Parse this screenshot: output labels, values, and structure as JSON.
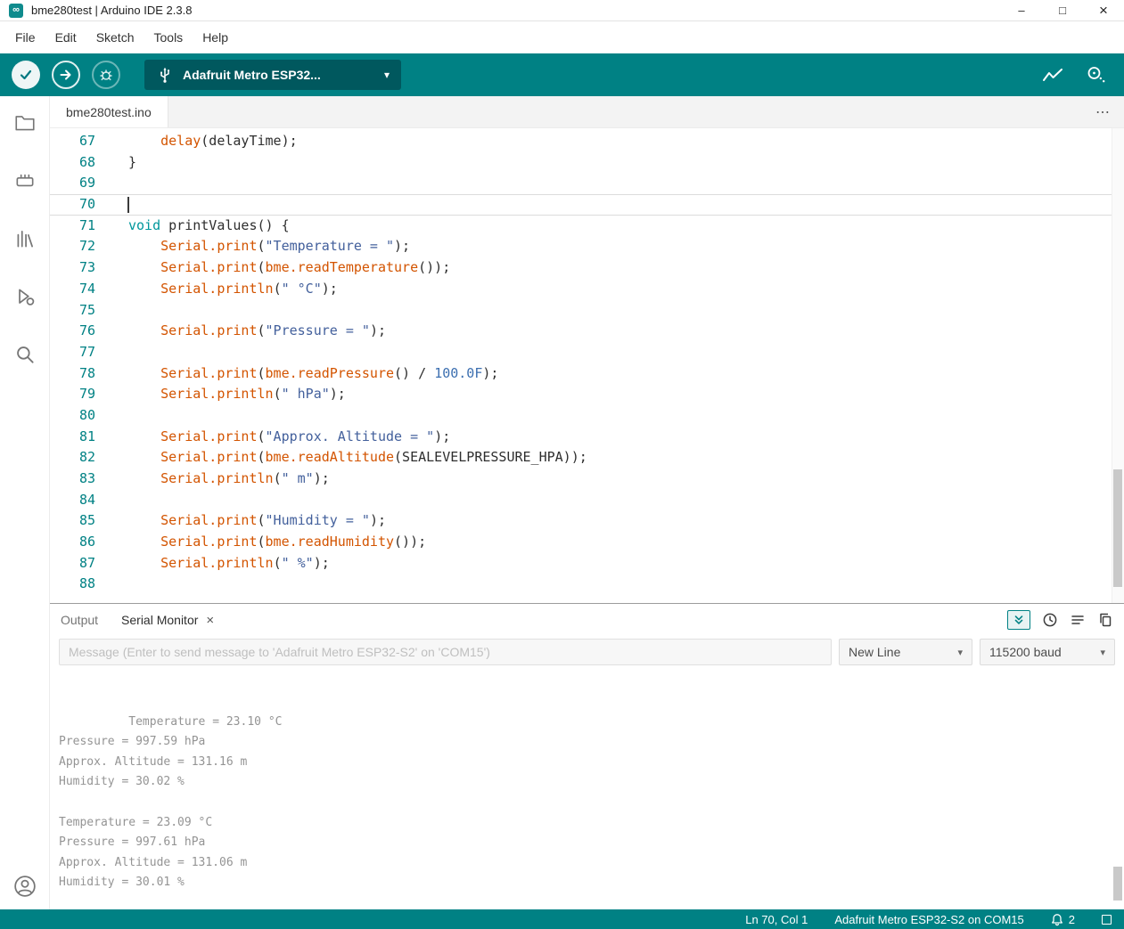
{
  "colors": {
    "accent_teal": "#008184",
    "selector_teal": "#00585e",
    "syntax_function": "#d35400",
    "syntax_keyword": "#00979c",
    "syntax_string": "#43609c",
    "syntax_number": "#3c6fb0",
    "syntax_plain": "#2e2e2e",
    "line_number": "#008184",
    "serial_text": "#949494"
  },
  "window": {
    "title": "bme280test | Arduino IDE 2.3.8",
    "controls": {
      "minimize": "–",
      "maximize": "□",
      "close": "×"
    }
  },
  "menu": {
    "items": [
      "File",
      "Edit",
      "Sketch",
      "Tools",
      "Help"
    ]
  },
  "toolbar": {
    "board_selector_label": "Adafruit Metro ESP32...",
    "dropdown_caret": "▾"
  },
  "editor_tabs": {
    "active_tab": "bme280test.ino",
    "overflow": "⋯"
  },
  "editor": {
    "lines": [
      {
        "num": 67,
        "tokens": [
          [
            "pl",
            "    "
          ],
          [
            "fn",
            "delay"
          ],
          [
            "pl",
            "(delayTime);"
          ]
        ]
      },
      {
        "num": 68,
        "tokens": [
          [
            "pl",
            "}"
          ]
        ]
      },
      {
        "num": 69,
        "tokens": []
      },
      {
        "num": 70,
        "tokens": [],
        "current": true
      },
      {
        "num": 71,
        "tokens": [
          [
            "kw",
            "void"
          ],
          [
            "pl",
            " printValues() {"
          ]
        ]
      },
      {
        "num": 72,
        "tokens": [
          [
            "pl",
            "    "
          ],
          [
            "fn",
            "Serial.print"
          ],
          [
            "pl",
            "("
          ],
          [
            "str",
            "\"Temperature = \""
          ],
          [
            "pl",
            ");"
          ]
        ]
      },
      {
        "num": 73,
        "tokens": [
          [
            "pl",
            "    "
          ],
          [
            "fn",
            "Serial.print"
          ],
          [
            "pl",
            "("
          ],
          [
            "fn",
            "bme.readTemperature"
          ],
          [
            "pl",
            "());"
          ]
        ]
      },
      {
        "num": 74,
        "tokens": [
          [
            "pl",
            "    "
          ],
          [
            "fn",
            "Serial.println"
          ],
          [
            "pl",
            "("
          ],
          [
            "str",
            "\" °C\""
          ],
          [
            "pl",
            ");"
          ]
        ]
      },
      {
        "num": 75,
        "tokens": []
      },
      {
        "num": 76,
        "tokens": [
          [
            "pl",
            "    "
          ],
          [
            "fn",
            "Serial.print"
          ],
          [
            "pl",
            "("
          ],
          [
            "str",
            "\"Pressure = \""
          ],
          [
            "pl",
            ");"
          ]
        ]
      },
      {
        "num": 77,
        "tokens": []
      },
      {
        "num": 78,
        "tokens": [
          [
            "pl",
            "    "
          ],
          [
            "fn",
            "Serial.print"
          ],
          [
            "pl",
            "("
          ],
          [
            "fn",
            "bme.readPressure"
          ],
          [
            "pl",
            "() / "
          ],
          [
            "num",
            "100.0F"
          ],
          [
            "pl",
            ");"
          ]
        ]
      },
      {
        "num": 79,
        "tokens": [
          [
            "pl",
            "    "
          ],
          [
            "fn",
            "Serial.println"
          ],
          [
            "pl",
            "("
          ],
          [
            "str",
            "\" hPa\""
          ],
          [
            "pl",
            ");"
          ]
        ]
      },
      {
        "num": 80,
        "tokens": []
      },
      {
        "num": 81,
        "tokens": [
          [
            "pl",
            "    "
          ],
          [
            "fn",
            "Serial.print"
          ],
          [
            "pl",
            "("
          ],
          [
            "str",
            "\"Approx. Altitude = \""
          ],
          [
            "pl",
            ");"
          ]
        ]
      },
      {
        "num": 82,
        "tokens": [
          [
            "pl",
            "    "
          ],
          [
            "fn",
            "Serial.print"
          ],
          [
            "pl",
            "("
          ],
          [
            "fn",
            "bme.readAltitude"
          ],
          [
            "pl",
            "(SEALEVELPRESSURE_HPA));"
          ]
        ]
      },
      {
        "num": 83,
        "tokens": [
          [
            "pl",
            "    "
          ],
          [
            "fn",
            "Serial.println"
          ],
          [
            "pl",
            "("
          ],
          [
            "str",
            "\" m\""
          ],
          [
            "pl",
            ");"
          ]
        ]
      },
      {
        "num": 84,
        "tokens": []
      },
      {
        "num": 85,
        "tokens": [
          [
            "pl",
            "    "
          ],
          [
            "fn",
            "Serial.print"
          ],
          [
            "pl",
            "("
          ],
          [
            "str",
            "\"Humidity = \""
          ],
          [
            "pl",
            ");"
          ]
        ]
      },
      {
        "num": 86,
        "tokens": [
          [
            "pl",
            "    "
          ],
          [
            "fn",
            "Serial.print"
          ],
          [
            "pl",
            "("
          ],
          [
            "fn",
            "bme.readHumidity"
          ],
          [
            "pl",
            "());"
          ]
        ]
      },
      {
        "num": 87,
        "tokens": [
          [
            "pl",
            "    "
          ],
          [
            "fn",
            "Serial.println"
          ],
          [
            "pl",
            "("
          ],
          [
            "str",
            "\" %\""
          ],
          [
            "pl",
            ");"
          ]
        ]
      },
      {
        "num": 88,
        "tokens": []
      }
    ]
  },
  "panel": {
    "tabs": {
      "output": "Output",
      "serial_monitor": "Serial Monitor",
      "close": "×"
    },
    "message_input_placeholder": "Message (Enter to send message to 'Adafruit Metro ESP32-S2' on 'COM15')",
    "line_ending_value": "New Line",
    "baud_value": "115200 baud",
    "output_lines": [
      "Temperature = 23.10 °C",
      "Pressure = 997.59 hPa",
      "Approx. Altitude = 131.16 m",
      "Humidity = 30.02 %",
      "",
      "Temperature = 23.09 °C",
      "Pressure = 997.61 hPa",
      "Approx. Altitude = 131.06 m",
      "Humidity = 30.01 %"
    ]
  },
  "status_bar": {
    "cursor_position": "Ln 70, Col 1",
    "board_connection": "Adafruit Metro ESP32-S2 on COM15",
    "notification_count": "2"
  }
}
